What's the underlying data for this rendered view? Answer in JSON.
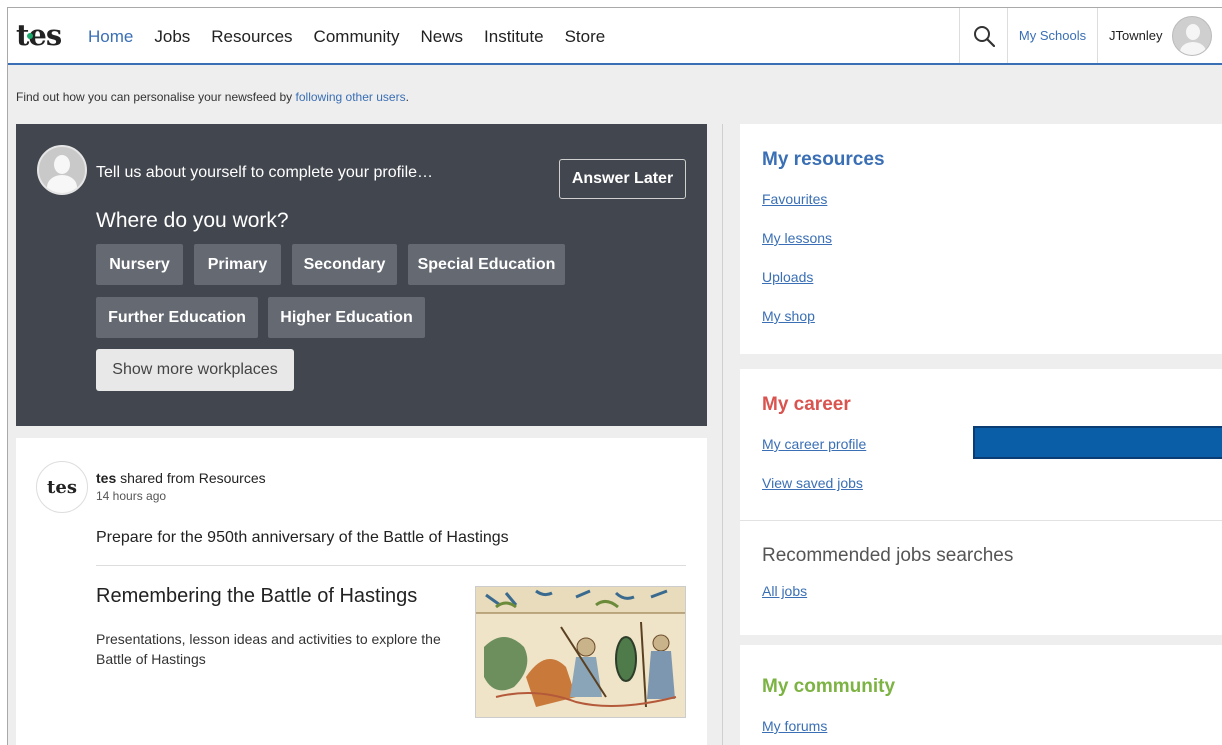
{
  "header": {
    "logo": "tes",
    "nav": [
      "Home",
      "Jobs",
      "Resources",
      "Community",
      "News",
      "Institute",
      "Store"
    ],
    "my_schools": "My Schools",
    "username": "JTownley",
    "icons": {
      "search": "search-icon",
      "avatar": "user-avatar-icon"
    },
    "accent_color": "#3a6fb5"
  },
  "info_bar": {
    "text": "Find out how you can personalise your newsfeed by",
    "link": "following other users",
    "end": "."
  },
  "profile_prompt": {
    "prompt": "Tell us about yourself to complete your profile…",
    "answer_later": "Answer Later",
    "question": "Where do you work?",
    "options": [
      "Nursery",
      "Primary",
      "Secondary",
      "Special Education",
      "Further Education",
      "Higher Education"
    ],
    "show_more": "Show more workplaces",
    "background_color": "#42464e"
  },
  "post": {
    "logo": "tes",
    "author": "tes",
    "shared_from": "shared from Resources",
    "time": "14 hours ago",
    "text": "Prepare for the 950th anniversary of the Battle of Hastings",
    "article_title": "Remembering the Battle of Hastings",
    "article_desc": "Presentations, lesson ideas and activities to explore the Battle of Hastings"
  },
  "my_resources": {
    "title": "My resources",
    "links": [
      "Favourites",
      "My lessons",
      "Uploads",
      "My shop"
    ],
    "title_color": "#3a6fb5"
  },
  "my_career": {
    "title": "My career",
    "links": [
      "My career profile",
      "View saved jobs"
    ],
    "recommended_title": "Recommended jobs searches",
    "recommended_links": [
      "All jobs"
    ],
    "title_color": "#d9534f"
  },
  "my_community": {
    "title": "My community",
    "links": [
      "My forums"
    ],
    "title_color": "#7cb342"
  }
}
